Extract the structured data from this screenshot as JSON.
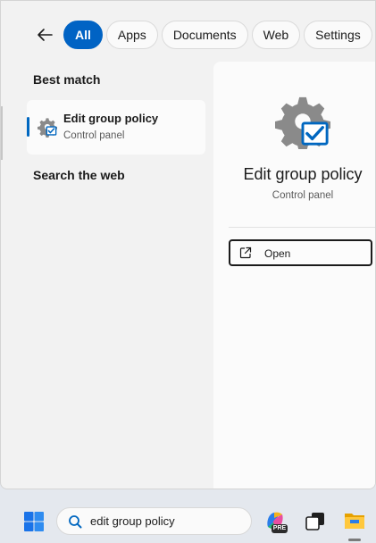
{
  "filters": {
    "back_label": "",
    "tabs": [
      {
        "label": "All",
        "active": true
      },
      {
        "label": "Apps",
        "active": false
      },
      {
        "label": "Documents",
        "active": false
      },
      {
        "label": "Web",
        "active": false
      },
      {
        "label": "Settings",
        "active": false
      }
    ]
  },
  "results": {
    "best_match_heading": "Best match",
    "search_web_heading": "Search the web",
    "best_match": {
      "title": "Edit group policy",
      "subtitle": "Control panel",
      "icon": "gear-checkbox-icon"
    }
  },
  "detail": {
    "title": "Edit group policy",
    "subtitle": "Control panel",
    "icon": "gear-checkbox-icon",
    "actions": [
      {
        "label": "Open",
        "icon": "open-external-icon"
      }
    ]
  },
  "taskbar": {
    "search_value": "edit group policy",
    "copilot_badge": "PRE",
    "icons": [
      "windows-start-icon",
      "search-icon",
      "copilot-icon",
      "task-view-icon",
      "file-explorer-icon"
    ]
  },
  "colors": {
    "accent": "#0063c4",
    "panel": "#f2f2f2",
    "card": "#fbfbfb"
  }
}
